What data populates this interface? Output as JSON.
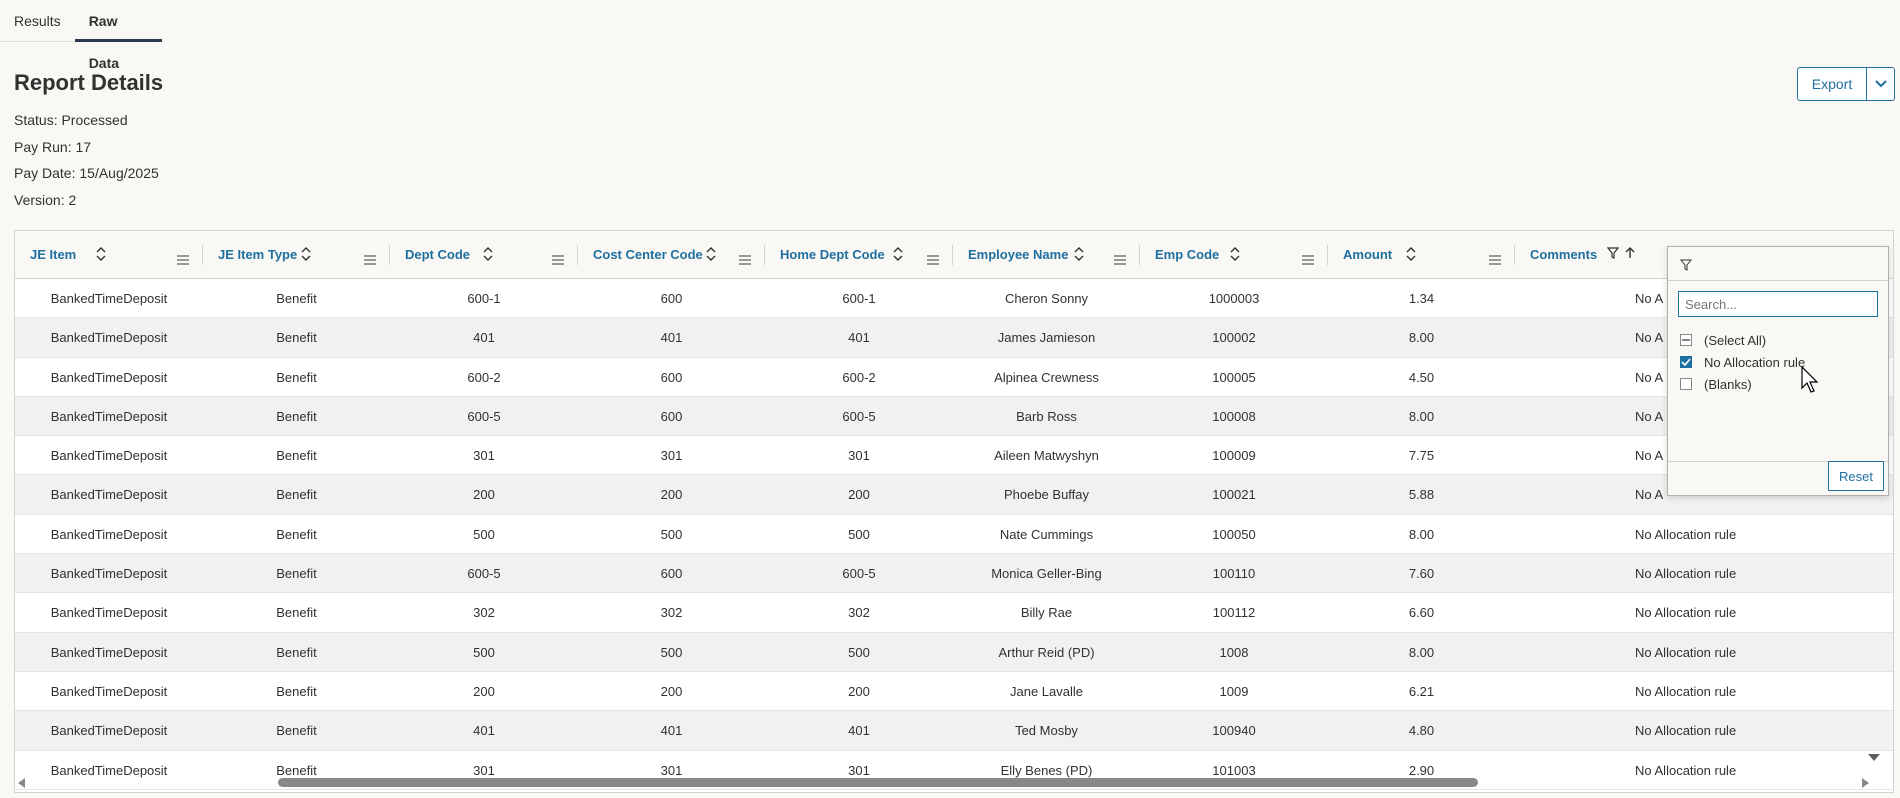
{
  "tabs": [
    {
      "label": "Results"
    },
    {
      "label": "Raw Data"
    }
  ],
  "report": {
    "title": "Report Details",
    "status": "Status: Processed",
    "pay_run": "Pay Run: 17",
    "pay_date": "Pay Date: 15/Aug/2025",
    "version": "Version: 2"
  },
  "toolbar": {
    "export_label": "Export",
    "export_caret_icon": "chevron-down-icon"
  },
  "grid": {
    "columns": [
      {
        "label": "JE Item"
      },
      {
        "label": "JE Item Type"
      },
      {
        "label": "Dept Code"
      },
      {
        "label": "Cost Center Code"
      },
      {
        "label": "Home Dept Code"
      },
      {
        "label": "Employee Name"
      },
      {
        "label": "Emp Code"
      },
      {
        "label": "Amount"
      },
      {
        "label": "Comments"
      }
    ],
    "rows": [
      [
        "BankedTimeDeposit",
        "Benefit",
        "600-1",
        "600",
        "600-1",
        "Cheron Sonny",
        "1000003",
        "1.34",
        "No A"
      ],
      [
        "BankedTimeDeposit",
        "Benefit",
        "401",
        "401",
        "401",
        "James Jamieson",
        "100002",
        "8.00",
        "No A"
      ],
      [
        "BankedTimeDeposit",
        "Benefit",
        "600-2",
        "600",
        "600-2",
        "Alpinea Crewness",
        "100005",
        "4.50",
        "No A"
      ],
      [
        "BankedTimeDeposit",
        "Benefit",
        "600-5",
        "600",
        "600-5",
        "Barb Ross",
        "100008",
        "8.00",
        "No A"
      ],
      [
        "BankedTimeDeposit",
        "Benefit",
        "301",
        "301",
        "301",
        "Aileen Matwyshyn",
        "100009",
        "7.75",
        "No A"
      ],
      [
        "BankedTimeDeposit",
        "Benefit",
        "200",
        "200",
        "200",
        "Phoebe Buffay",
        "100021",
        "5.88",
        "No A"
      ],
      [
        "BankedTimeDeposit",
        "Benefit",
        "500",
        "500",
        "500",
        "Nate Cummings",
        "100050",
        "8.00",
        "No Allocation rule"
      ],
      [
        "BankedTimeDeposit",
        "Benefit",
        "600-5",
        "600",
        "600-5",
        "Monica Geller-Bing",
        "100110",
        "7.60",
        "No Allocation rule"
      ],
      [
        "BankedTimeDeposit",
        "Benefit",
        "302",
        "302",
        "302",
        "Billy Rae",
        "100112",
        "6.60",
        "No Allocation rule"
      ],
      [
        "BankedTimeDeposit",
        "Benefit",
        "500",
        "500",
        "500",
        "Arthur Reid (PD)",
        "1008",
        "8.00",
        "No Allocation rule"
      ],
      [
        "BankedTimeDeposit",
        "Benefit",
        "200",
        "200",
        "200",
        "Jane Lavalle",
        "1009",
        "6.21",
        "No Allocation rule"
      ],
      [
        "BankedTimeDeposit",
        "Benefit",
        "401",
        "401",
        "401",
        "Ted Mosby",
        "100940",
        "4.80",
        "No Allocation rule"
      ],
      [
        "BankedTimeDeposit",
        "Benefit",
        "301",
        "301",
        "301",
        "Elly Benes (PD)",
        "101003",
        "2.90",
        "No Allocation rule"
      ]
    ]
  },
  "filter_popup": {
    "search_placeholder": "Search...",
    "options": [
      {
        "label": "(Select All)",
        "state": "indeterminate"
      },
      {
        "label": "No Allocation rule",
        "state": "checked"
      },
      {
        "label": "(Blanks)",
        "state": "unchecked"
      }
    ],
    "reset_label": "Reset"
  },
  "colors": {
    "accent": "#1f6fa0",
    "background": "#f9f8f5",
    "row_alt": "#f1f1f1"
  }
}
